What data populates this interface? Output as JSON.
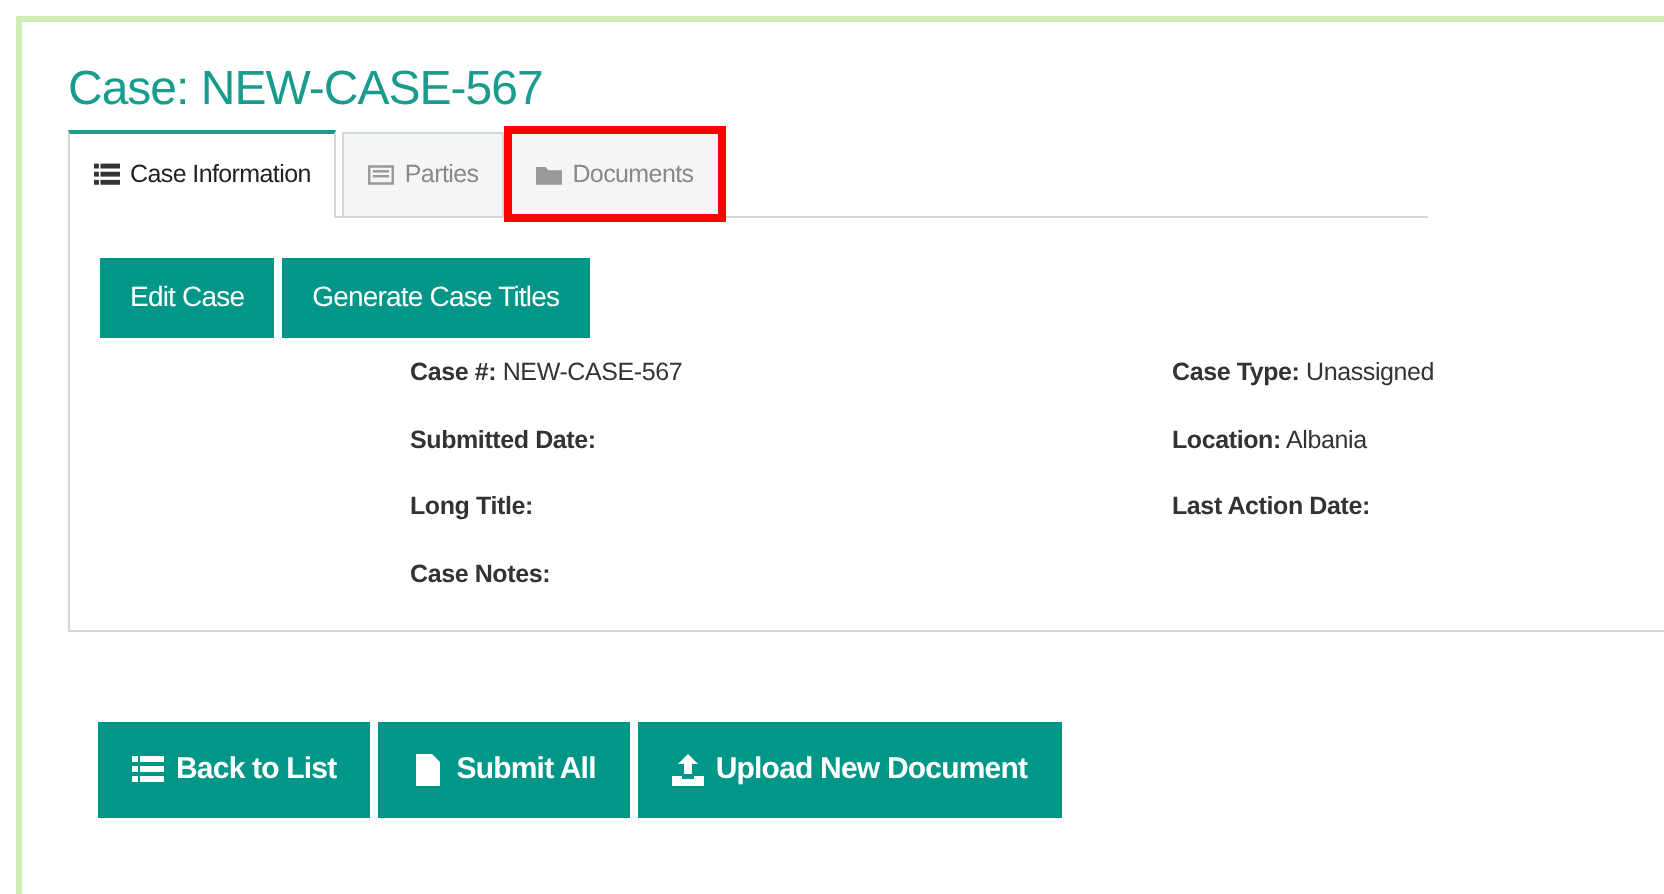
{
  "title": "Case: NEW-CASE-567",
  "tabs": [
    {
      "label": "Case Information",
      "selected": true,
      "highlighted": false
    },
    {
      "label": "Parties",
      "selected": false,
      "highlighted": false
    },
    {
      "label": "Documents",
      "selected": false,
      "highlighted": true
    }
  ],
  "actions": [
    "Edit Case",
    "Generate Case Titles"
  ],
  "fields_left": [
    {
      "label": "Case #:",
      "value": "NEW-CASE-567"
    },
    {
      "label": "Submitted Date:"
    },
    {
      "label": "Long Title:"
    },
    {
      "label": "Case Notes:"
    }
  ],
  "fields_right": [
    {
      "label": "Case Type:",
      "value": "Unassigned"
    },
    {
      "label": "Location:",
      "value": "Albania"
    },
    {
      "label": "Last Action Date:"
    }
  ],
  "bottom_buttons": [
    "Back to List",
    "Submit All",
    "Upload New Document"
  ]
}
